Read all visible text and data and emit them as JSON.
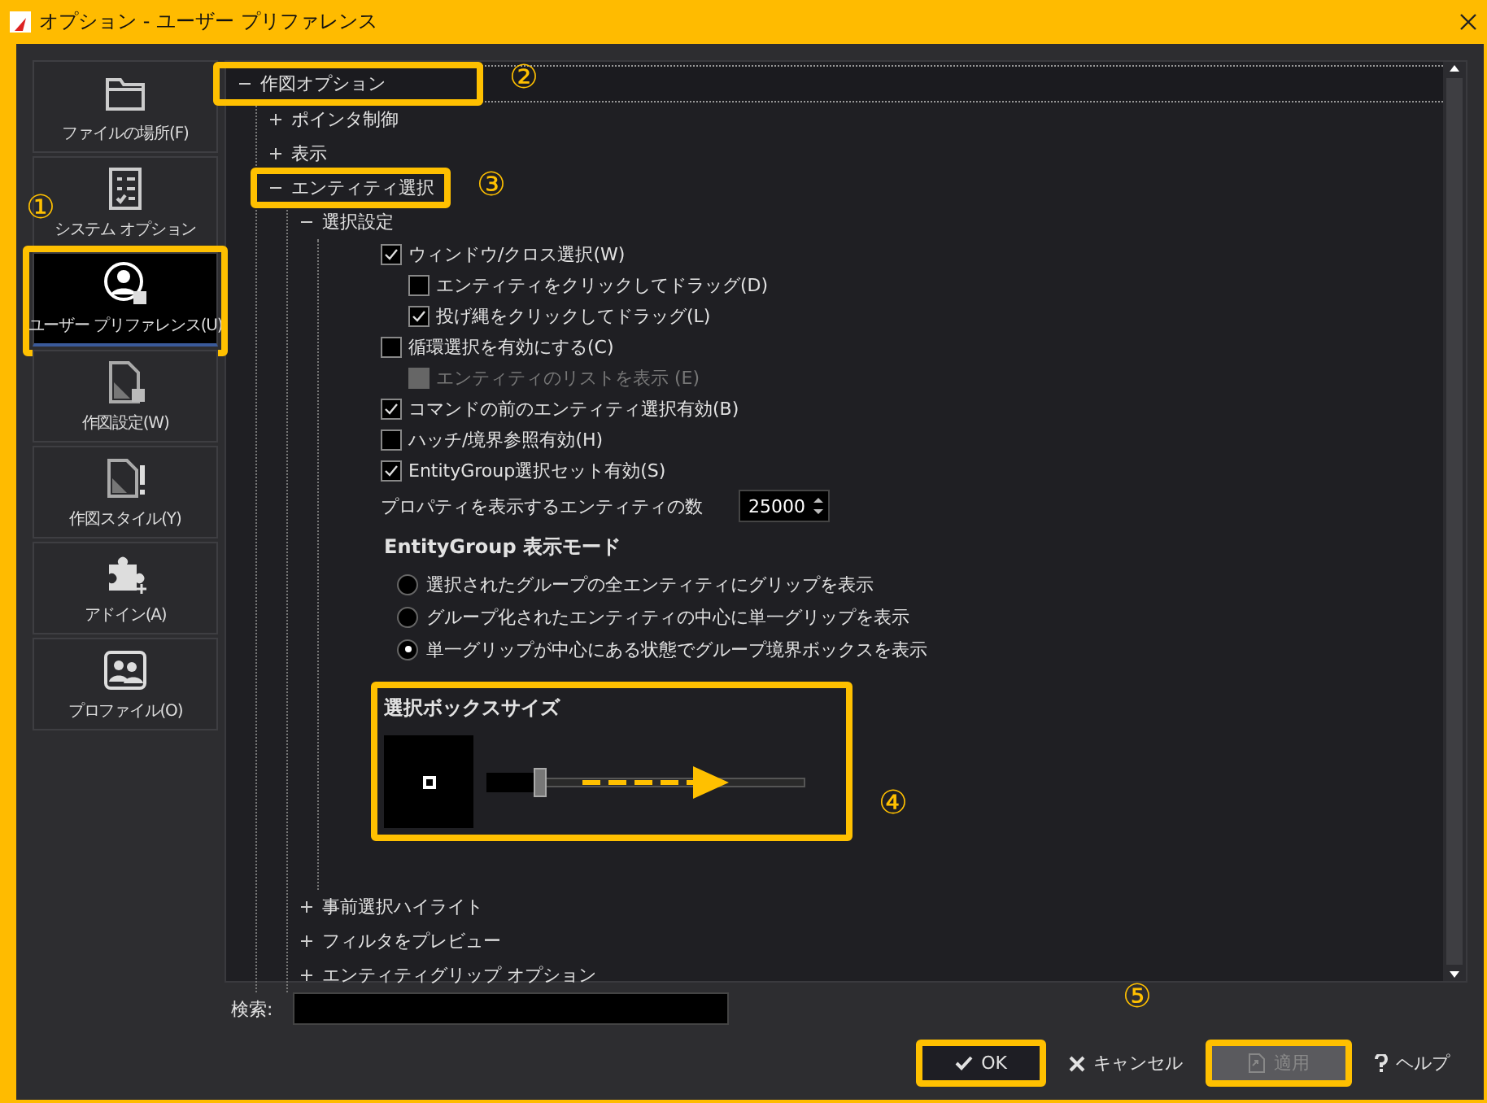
{
  "window": {
    "title": "オプション - ユーザー プリファレンス"
  },
  "sidebar": {
    "items": [
      {
        "label": "ファイルの場所(F)",
        "selected": false,
        "highlighted": false
      },
      {
        "label": "システム オプション",
        "selected": false,
        "highlighted": false
      },
      {
        "label": "ユーザー プリファレンス(U)",
        "selected": true,
        "highlighted": true,
        "callout": "①"
      },
      {
        "label": "作図設定(W)",
        "selected": false,
        "highlighted": false
      },
      {
        "label": "作図スタイル(Y)",
        "selected": false,
        "highlighted": false
      },
      {
        "label": "アドイン(A)",
        "selected": false,
        "highlighted": false
      },
      {
        "label": "プロファイル(O)",
        "selected": false,
        "highlighted": false
      }
    ]
  },
  "tree": [
    {
      "label": "作図オプション",
      "expanded": true,
      "highlighted": true,
      "callout": "②",
      "children": [
        {
          "label": "ポインタ制御",
          "expanded": false,
          "highlighted": false
        },
        {
          "label": "表示",
          "expanded": false,
          "highlighted": false
        },
        {
          "label": "エンティティ選択",
          "expanded": true,
          "highlighted": true,
          "callout": "③",
          "children": [
            {
              "label": "選択設定",
              "expanded": true,
              "highlighted": false,
              "settings": [
                {
                  "kind": "checkbox",
                  "label": "ウィンドウ/クロス選択(W)",
                  "checked": true,
                  "disabled": false,
                  "children": [
                    {
                      "kind": "checkbox",
                      "label": "エンティティをクリックしてドラッグ(D)",
                      "checked": false,
                      "disabled": false
                    },
                    {
                      "kind": "checkbox",
                      "label": "投げ縄をクリックしてドラッグ(L)",
                      "checked": true,
                      "disabled": false
                    }
                  ]
                },
                {
                  "kind": "checkbox",
                  "label": "循環選択を有効にする(C)",
                  "checked": false,
                  "disabled": false,
                  "children": [
                    {
                      "kind": "checkbox",
                      "label": "エンティティのリストを表示 (E)",
                      "checked": false,
                      "disabled": true
                    }
                  ]
                },
                {
                  "kind": "checkbox",
                  "label": "コマンドの前のエンティティ選択有効(B)",
                  "checked": true,
                  "disabled": false
                },
                {
                  "kind": "checkbox",
                  "label": "ハッチ/境界参照有効(H)",
                  "checked": false,
                  "disabled": false
                },
                {
                  "kind": "checkbox",
                  "label": "EntityGroup選択セット有効(S)",
                  "checked": true,
                  "disabled": false
                },
                {
                  "kind": "number",
                  "label": "プロパティを表示するエンティティの数",
                  "value": "25000"
                },
                {
                  "kind": "heading",
                  "label": "EntityGroup 表示モード"
                },
                {
                  "kind": "radio",
                  "label": "選択されたグループの全エンティティにグリップを表示",
                  "selected": false
                },
                {
                  "kind": "radio",
                  "label": "グループ化されたエンティティの中心に単一グリップを表示",
                  "selected": false
                },
                {
                  "kind": "radio",
                  "label": "単一グリップが中心にある状態でグループ境界ボックスを表示",
                  "selected": true
                },
                {
                  "kind": "slider_group",
                  "title": "選択ボックスサイズ",
                  "level": 0.17,
                  "highlighted": true,
                  "callout": "④",
                  "arrow": true
                }
              ]
            },
            {
              "label": "事前選択ハイライト",
              "expanded": false,
              "highlighted": false
            },
            {
              "label": "フィルタをプレビュー",
              "expanded": false,
              "highlighted": false
            },
            {
              "label": "エンティティグリップ オプション",
              "expanded": false,
              "highlighted": false
            }
          ]
        }
      ]
    }
  ],
  "search": {
    "label": "検索:"
  },
  "buttons": [
    {
      "label": "OK",
      "kind": "ok",
      "disabled": false,
      "highlighted": true
    },
    {
      "label": "キャンセル",
      "kind": "cancel",
      "disabled": false,
      "highlighted": false
    },
    {
      "label": "適用",
      "kind": "apply",
      "disabled": true,
      "highlighted": true
    },
    {
      "label": "ヘルプ",
      "kind": "help",
      "disabled": false,
      "highlighted": false
    }
  ],
  "buttons_callout": "⑤"
}
